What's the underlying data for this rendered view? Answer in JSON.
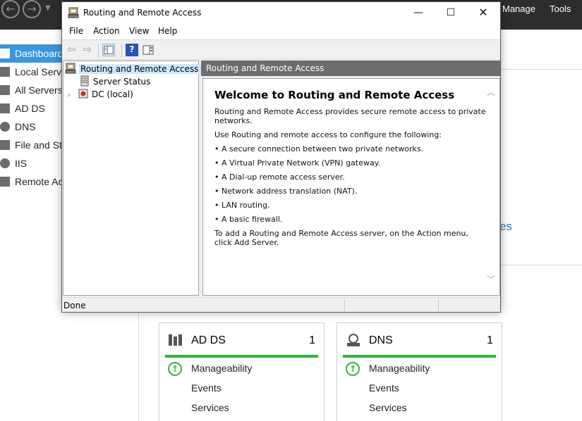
{
  "server_manager": {
    "menu": {
      "manage": "Manage",
      "tools": "Tools"
    },
    "sidebar": {
      "items": [
        {
          "label": "Dashboard",
          "icon": "dashboard-icon",
          "active": true
        },
        {
          "label": "Local Server",
          "icon": "server-icon"
        },
        {
          "label": "All Servers",
          "icon": "servers-icon"
        },
        {
          "label": "AD DS",
          "icon": "ad-ds-icon"
        },
        {
          "label": "DNS",
          "icon": "dns-icon"
        },
        {
          "label": "File and Storage Services",
          "icon": "file-storage-icon"
        },
        {
          "label": "IIS",
          "icon": "iis-icon"
        },
        {
          "label": "Remote Access",
          "icon": "remote-access-icon"
        }
      ]
    },
    "link_fragment": "es",
    "tiles": [
      {
        "title": "AD DS",
        "count": "1",
        "rows": [
          "Manageability",
          "Events",
          "Services"
        ],
        "status_color": "#2db83d"
      },
      {
        "title": "DNS",
        "count": "1",
        "rows": [
          "Manageability",
          "Events",
          "Services"
        ],
        "status_color": "#2db83d"
      }
    ]
  },
  "rras": {
    "title": "Routing and Remote Access",
    "menu": {
      "file": "File",
      "action": "Action",
      "view": "View",
      "help": "Help"
    },
    "tree": {
      "root": "Routing and Remote Access",
      "children": [
        "Server Status",
        "DC (local)"
      ]
    },
    "result_header": "Routing and Remote Access",
    "welcome": {
      "title": "Welcome to Routing and Remote Access",
      "intro": "Routing and Remote Access provides secure remote access to private networks.",
      "use": "Use Routing and remote access to configure the following:",
      "bullets": [
        "• A secure connection between two private networks.",
        "• A Virtual Private Network (VPN) gateway.",
        "• A Dial-up remote access server.",
        "• Network address translation (NAT).",
        "• LAN routing.",
        "• A basic firewall."
      ],
      "outro": "To add a Routing and Remote Access server, on the Action menu, click Add Server."
    },
    "status": "Done"
  }
}
